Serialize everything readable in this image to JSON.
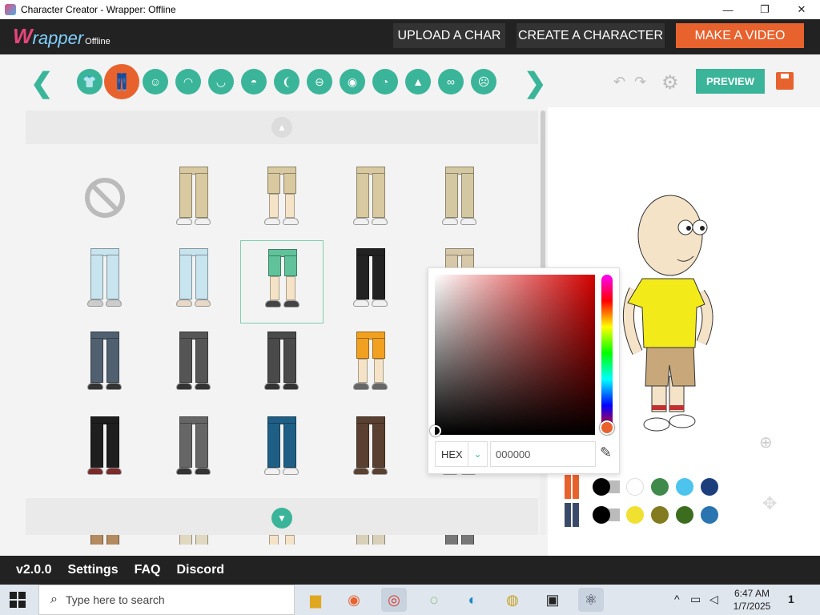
{
  "window": {
    "title": "Character Creator - Wrapper: Offline",
    "controls": [
      "—",
      "❐",
      "✕"
    ]
  },
  "header": {
    "logo_w": "W",
    "logo_text": "rapper",
    "logo_suffix": "Offline",
    "upload_label": "UPLOAD A CHAR",
    "create_label": "CREATE A CHARACTER",
    "make_video_label": "MAKE A VIDEO"
  },
  "toolbar": {
    "prev_glyph": "❮",
    "next_glyph": "❯",
    "categories": [
      {
        "name": "upper-body",
        "glyph": "👕"
      },
      {
        "name": "lower-body",
        "glyph": "👖",
        "active": true
      },
      {
        "name": "face",
        "glyph": "☺"
      },
      {
        "name": "hair",
        "glyph": "◠"
      },
      {
        "name": "facial-hair",
        "glyph": "◡"
      },
      {
        "name": "mouth",
        "glyph": "◓"
      },
      {
        "name": "ear",
        "glyph": "❨"
      },
      {
        "name": "eyebrows",
        "glyph": "⊖"
      },
      {
        "name": "eyes",
        "glyph": "◉"
      },
      {
        "name": "eyelids",
        "glyph": "◔"
      },
      {
        "name": "nose",
        "glyph": "▲"
      },
      {
        "name": "glasses",
        "glyph": "∞"
      },
      {
        "name": "mask",
        "glyph": "☹"
      }
    ],
    "preview_label": "PREVIEW",
    "undo_glyph": "↶",
    "redo_glyph": "↷",
    "gear_glyph": "⚙"
  },
  "grid": {
    "scroll_up_glyph": "▲",
    "scroll_down_glyph": "▼",
    "items": [
      {
        "type": "none"
      },
      {
        "type": "pants",
        "color": "#d8c9a0",
        "shoe": "#f0f0f0"
      },
      {
        "type": "shorts",
        "color": "#d8c9a0",
        "shoe": "#f0f0f0"
      },
      {
        "type": "pants",
        "color": "#d8c9a0",
        "shoe": "#f0f0f0"
      },
      {
        "type": "pants",
        "color": "#d4c8a2",
        "shoe": "#f0f0f0"
      },
      {
        "type": "pants",
        "color": "#c8e4ee",
        "shoe": "#cccccc"
      },
      {
        "type": "pants",
        "color": "#c8e4ee",
        "shoe": "#e8d8c8"
      },
      {
        "type": "shorts",
        "color": "#5fc29a",
        "shoe": "#444444",
        "selected": true
      },
      {
        "type": "pants",
        "color": "#222222",
        "shoe": "#f0f0f0"
      },
      {
        "type": "pants",
        "color": "#d6c8a8",
        "shoe": "#f0f0f0"
      },
      {
        "type": "pants",
        "color": "#506070",
        "shoe": "#333333"
      },
      {
        "type": "pants",
        "color": "#555555",
        "shoe": "#333333"
      },
      {
        "type": "pants",
        "color": "#4a4a4a",
        "shoe": "#333333"
      },
      {
        "type": "shorts",
        "color": "#f2a020",
        "shoe": "#666666"
      },
      {
        "type": "pants",
        "color": "#c0b8a0",
        "shoe": "#555555"
      },
      {
        "type": "pants",
        "color": "#1e1e1e",
        "shoe": "#7a2a2a"
      },
      {
        "type": "pants",
        "color": "#666666",
        "shoe": "#333333"
      },
      {
        "type": "pants",
        "color": "#1f5f86",
        "shoe": "#f0f0f0"
      },
      {
        "type": "pants",
        "color": "#5a4030",
        "shoe": "#5a4030"
      },
      {
        "type": "pants",
        "color": "#6a5030",
        "shoe": "#5a4030"
      },
      {
        "type": "pants",
        "color": "#b48a60",
        "shoe": "#999999"
      },
      {
        "type": "pants",
        "color": "#e0d8c0",
        "shoe": "#cccccc"
      },
      {
        "type": "shorts",
        "color": "#cc5555",
        "shoe": "#cccccc"
      },
      {
        "type": "pants",
        "color": "#d8d0b8",
        "shoe": "#cccccc"
      },
      {
        "type": "pants",
        "color": "#777777",
        "shoe": "#cccccc"
      }
    ]
  },
  "color_picker": {
    "mode_label": "HEX",
    "mode_chevron": "⌄",
    "hex_value": "000000",
    "eyedropper_glyph": "✎"
  },
  "preview": {
    "zoom_glyph": "⊕",
    "move_glyph": "✥",
    "swatch_rows": [
      {
        "part": "pants",
        "part_color": "#e8622e",
        "colors": [
          "#ffffff",
          "#3f8a4a",
          "#4cc4ee",
          "#1c3f7c"
        ]
      },
      {
        "part": "legs",
        "part_color": "#3a4a6a",
        "colors": [
          "#f0e030",
          "#837b1f",
          "#3c6d1f",
          "#2a74b0"
        ]
      }
    ]
  },
  "footer": {
    "version": "v2.0.0",
    "settings": "Settings",
    "faq": "FAQ",
    "discord": "Discord"
  },
  "taskbar": {
    "search_placeholder": "Type here to search",
    "time": "6:47 AM",
    "date": "1/7/2025",
    "apps": [
      "file-explorer",
      "firefox",
      "chrome",
      "app-green",
      "edge",
      "app-yellow",
      "7zip",
      "electron"
    ],
    "notification_count": "1"
  }
}
